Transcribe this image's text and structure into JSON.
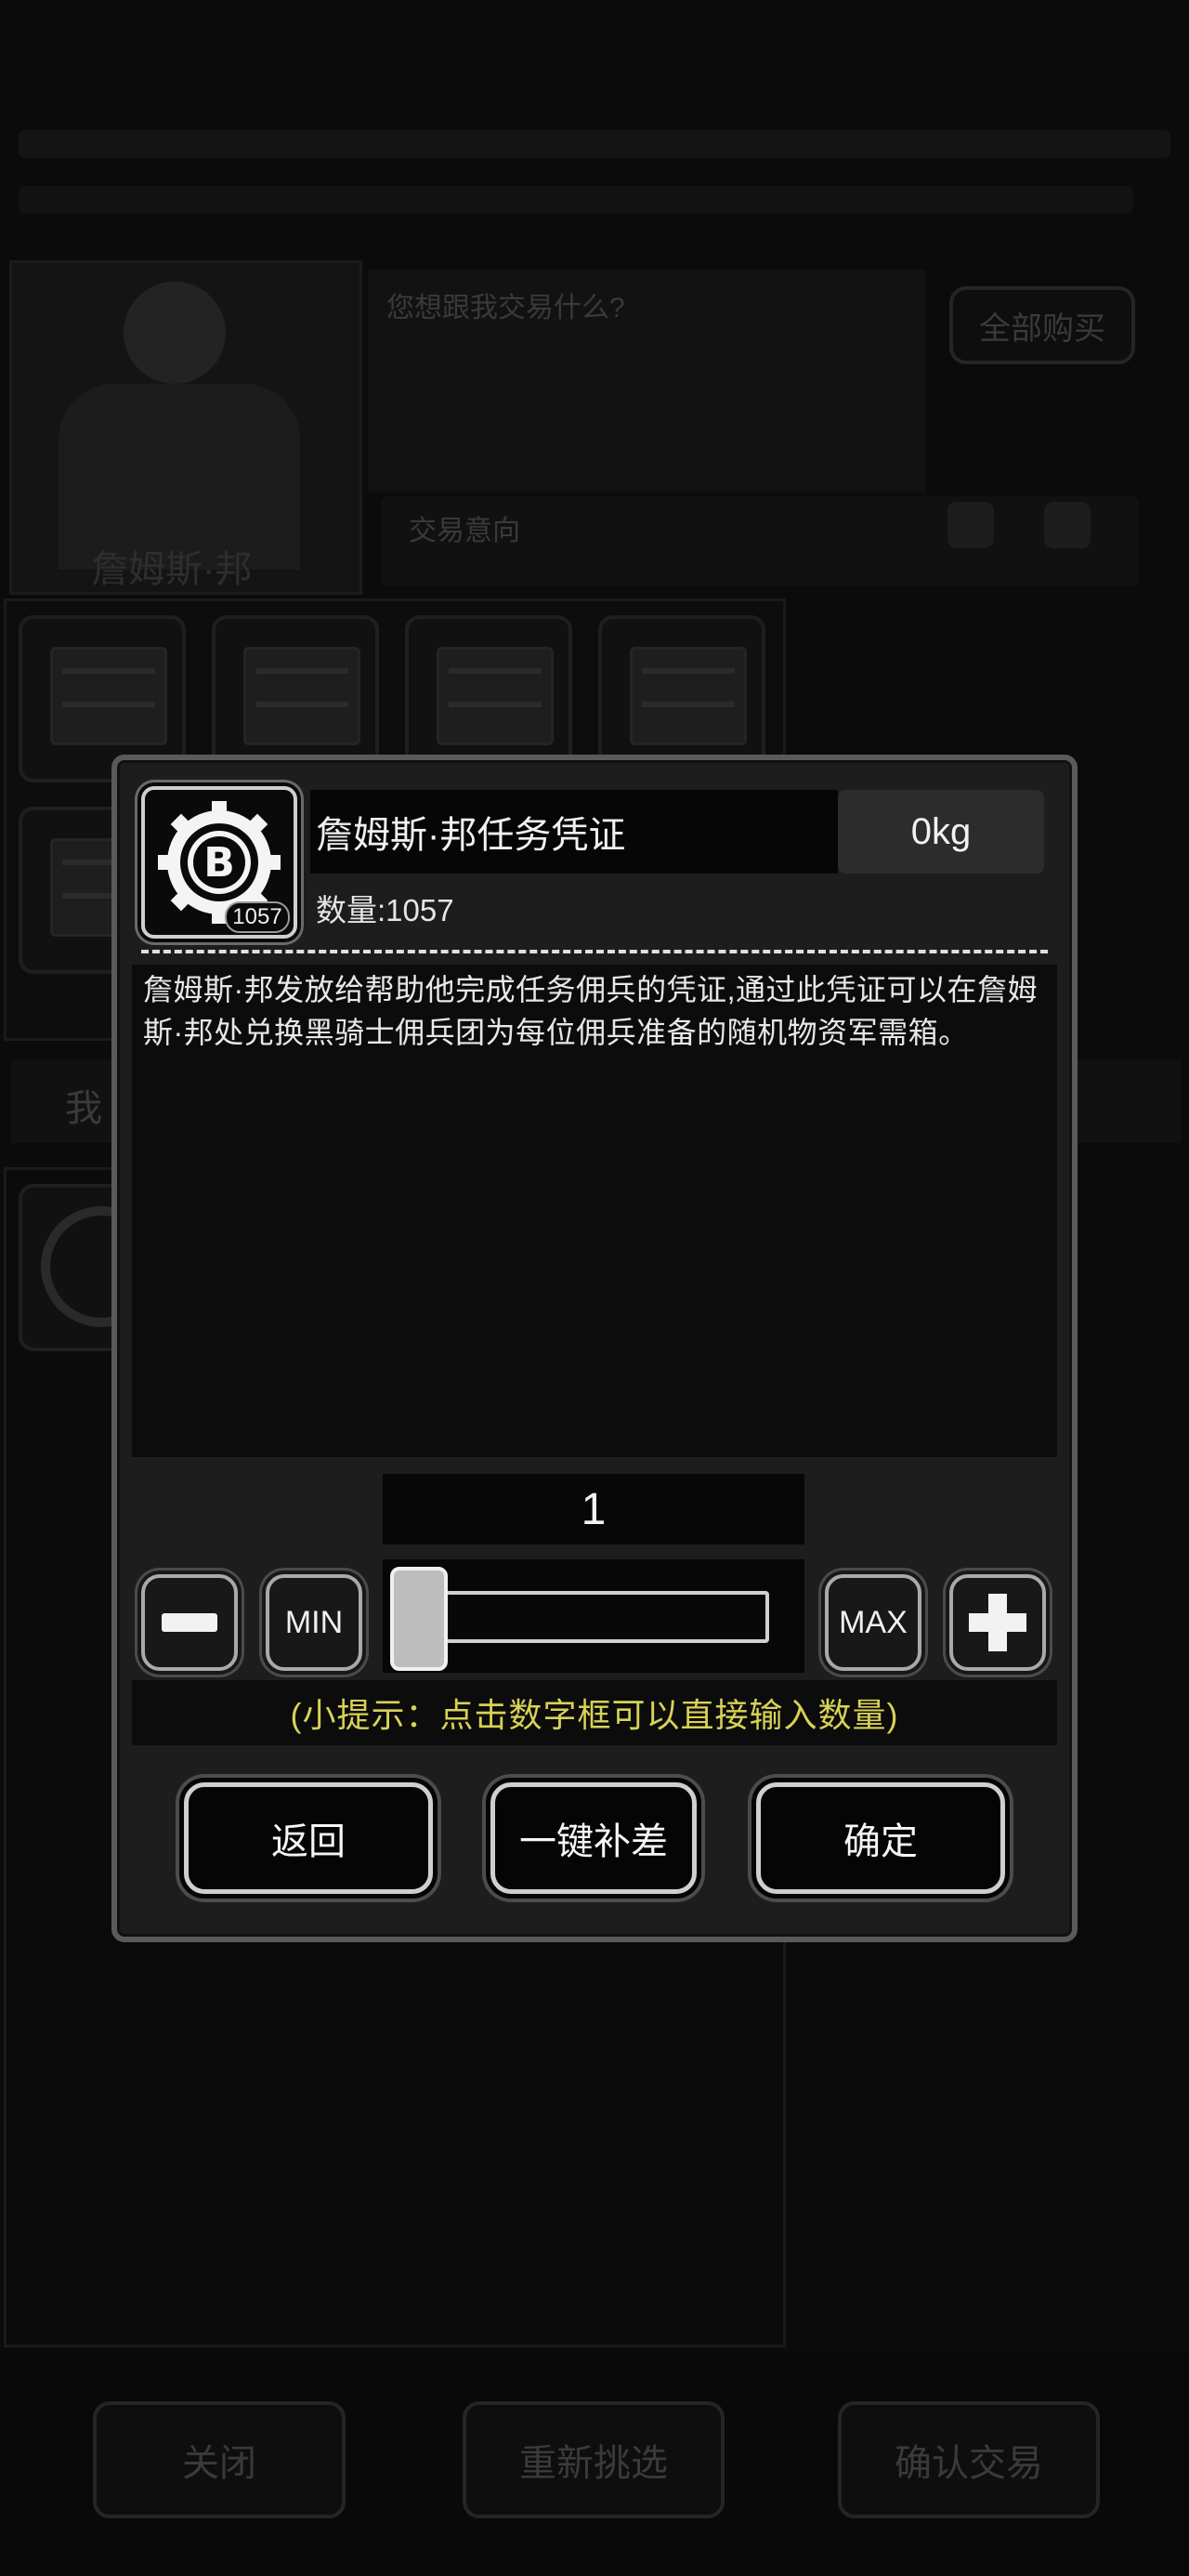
{
  "background": {
    "trader_name": "詹姆斯·邦",
    "dialog_prompt": "您想跟我交易什么?",
    "buy_all_label": "全部购买",
    "trade_intent_label": "交易意向",
    "my_tab_label": "我",
    "close_label": "关闭",
    "reselect_label": "重新挑选",
    "confirm_trade_label": "确认交易"
  },
  "item": {
    "name": "詹姆斯·邦任务凭证",
    "weight": "0kg",
    "badge_count": "1057",
    "quantity_text": "数量:1057",
    "description": "詹姆斯·邦发放给帮助他完成任务佣兵的凭证,通过此凭证可以在詹姆斯·邦处兑换黑骑士佣兵团为每位佣兵准备的随机物资军需箱。"
  },
  "quantity": {
    "value": "1",
    "min_label": "MIN",
    "max_label": "MAX",
    "slider_fraction": 0.0
  },
  "tip": "(小提示：点击数字框可以直接输入数量)",
  "actions": {
    "back": "返回",
    "fill_gap": "一键补差",
    "confirm": "确定"
  },
  "colors": {
    "tip": "#d8d256",
    "panel": "#1d1d1d",
    "accent_border": "#cfcfcf"
  }
}
